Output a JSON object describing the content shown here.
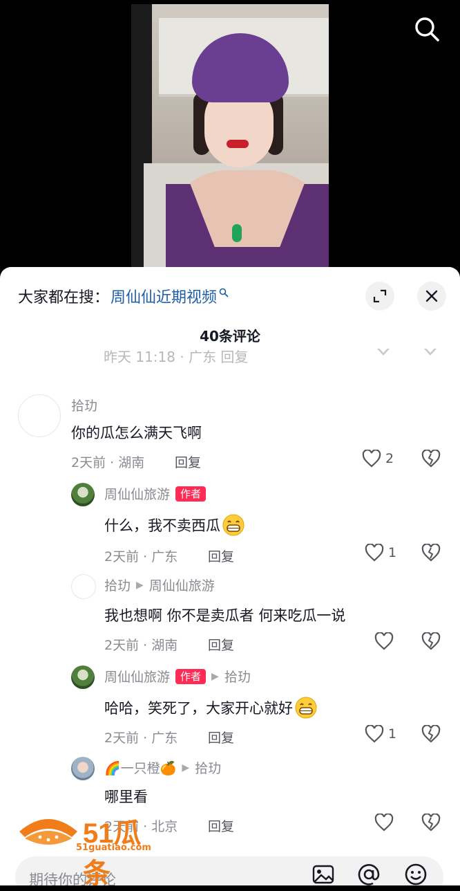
{
  "video": {
    "search_icon": "search-icon"
  },
  "sheet": {
    "trending_prefix": "大家都在搜：",
    "trending_link": "周仙仙近期视频",
    "comment_count": "40条评论",
    "ghost_meta": "昨天 11:18 · 广东   回复"
  },
  "comments": [
    {
      "user": "拾玏",
      "text": "你的瓜怎么满天飞啊",
      "meta": "2天前 · 湖南",
      "reply": "回复",
      "likes": "2"
    },
    {
      "user": "周仙仙旅游",
      "badge": "作者",
      "text": "什么，我不卖西瓜",
      "meta": "2天前 · 广东",
      "reply": "回复",
      "likes": "1"
    },
    {
      "user": "拾玏",
      "reply_to": "周仙仙旅游",
      "text": "我也想啊 你不是卖瓜者 何来吃瓜一说",
      "meta": "2天前 · 湖南",
      "reply": "回复",
      "likes": ""
    },
    {
      "user": "周仙仙旅游",
      "badge": "作者",
      "reply_to": "拾玏",
      "text": "哈哈，笑死了，大家开心就好",
      "meta": "2天前 · 广东",
      "reply": "回复",
      "likes": "1"
    },
    {
      "user": "🌈一只橙🍊",
      "reply_to": "拾玏",
      "text": "哪里看",
      "meta": "2天前 · 北京",
      "reply": "回复",
      "likes": ""
    }
  ],
  "input": {
    "placeholder": "期待你的评论"
  },
  "watermark": {
    "text": "51瓜条",
    "sub": "51guatiao.com"
  },
  "colors": {
    "accent": "#fe2c55",
    "link": "#1d5ea8",
    "watermark": "#f07d1a"
  }
}
